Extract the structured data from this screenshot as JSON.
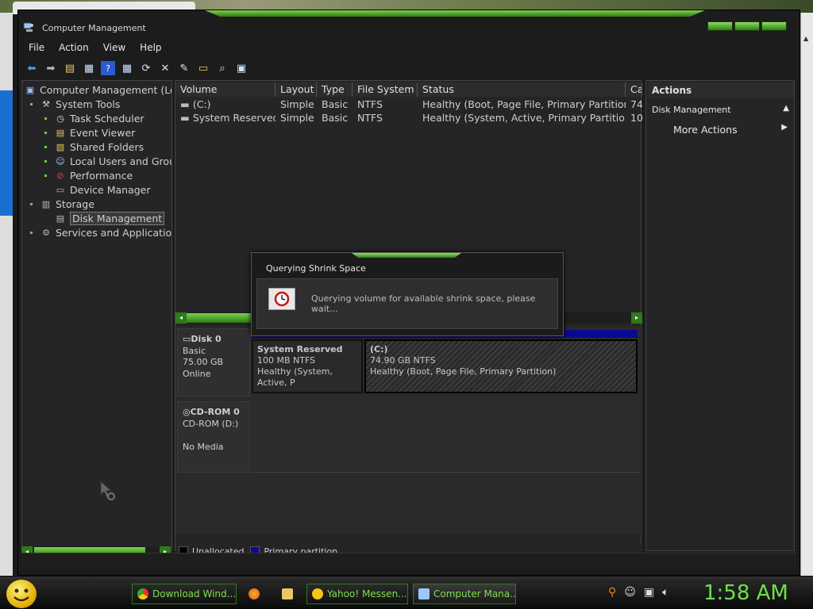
{
  "window": {
    "title": "Computer Management",
    "menu": [
      "File",
      "Action",
      "View",
      "Help"
    ]
  },
  "tree": {
    "root": "Computer Management (Loc",
    "items": [
      {
        "label": "System Tools",
        "level": 1
      },
      {
        "label": "Task Scheduler",
        "level": 2
      },
      {
        "label": "Event Viewer",
        "level": 2
      },
      {
        "label": "Shared Folders",
        "level": 2
      },
      {
        "label": "Local Users and Grou",
        "level": 2
      },
      {
        "label": "Performance",
        "level": 2
      },
      {
        "label": "Device Manager",
        "level": 2
      },
      {
        "label": "Storage",
        "level": 1
      },
      {
        "label": "Disk Management",
        "level": 2,
        "selected": true
      },
      {
        "label": "Services and Applications",
        "level": 1
      }
    ]
  },
  "volume_list": {
    "columns": [
      "Volume",
      "Layout",
      "Type",
      "File System",
      "Status",
      "Ca"
    ],
    "rows": [
      [
        "(C:)",
        "Simple",
        "Basic",
        "NTFS",
        "Healthy (Boot, Page File, Primary Partition)",
        "74"
      ],
      [
        "System Reserved",
        "Simple",
        "Basic",
        "NTFS",
        "Healthy (System, Active, Primary Partition)",
        "10"
      ]
    ]
  },
  "disks": {
    "disk0": {
      "name": "Disk 0",
      "type": "Basic",
      "size": "75.00 GB",
      "state": "Online"
    },
    "cdrom0": {
      "name": "CD-ROM 0",
      "drive": "CD-ROM (D:)",
      "state": "No Media"
    },
    "partitions": [
      {
        "name": "System Reserved",
        "size": "100 MB NTFS",
        "status": "Healthy (System, Active, P"
      },
      {
        "name": "(C:)",
        "size": "74.90 GB NTFS",
        "status": "Healthy (Boot, Page File, Primary Partition)"
      }
    ]
  },
  "legend": {
    "unallocated": "Unallocated",
    "primary": "Primary partition"
  },
  "actions": {
    "header": "Actions",
    "section": "Disk Management",
    "more": "More Actions"
  },
  "dialog": {
    "title": "Querying Shrink Space",
    "message": "Querying volume for available shrink space, please wait..."
  },
  "taskbar": {
    "buttons": [
      "Download Wind...",
      "Yahoo! Messen...",
      "Computer Mana..."
    ],
    "clock": "1:58 AM"
  },
  "colors": {
    "accent_green": "#6ee04a",
    "primary_partition": "#0a0a90"
  }
}
